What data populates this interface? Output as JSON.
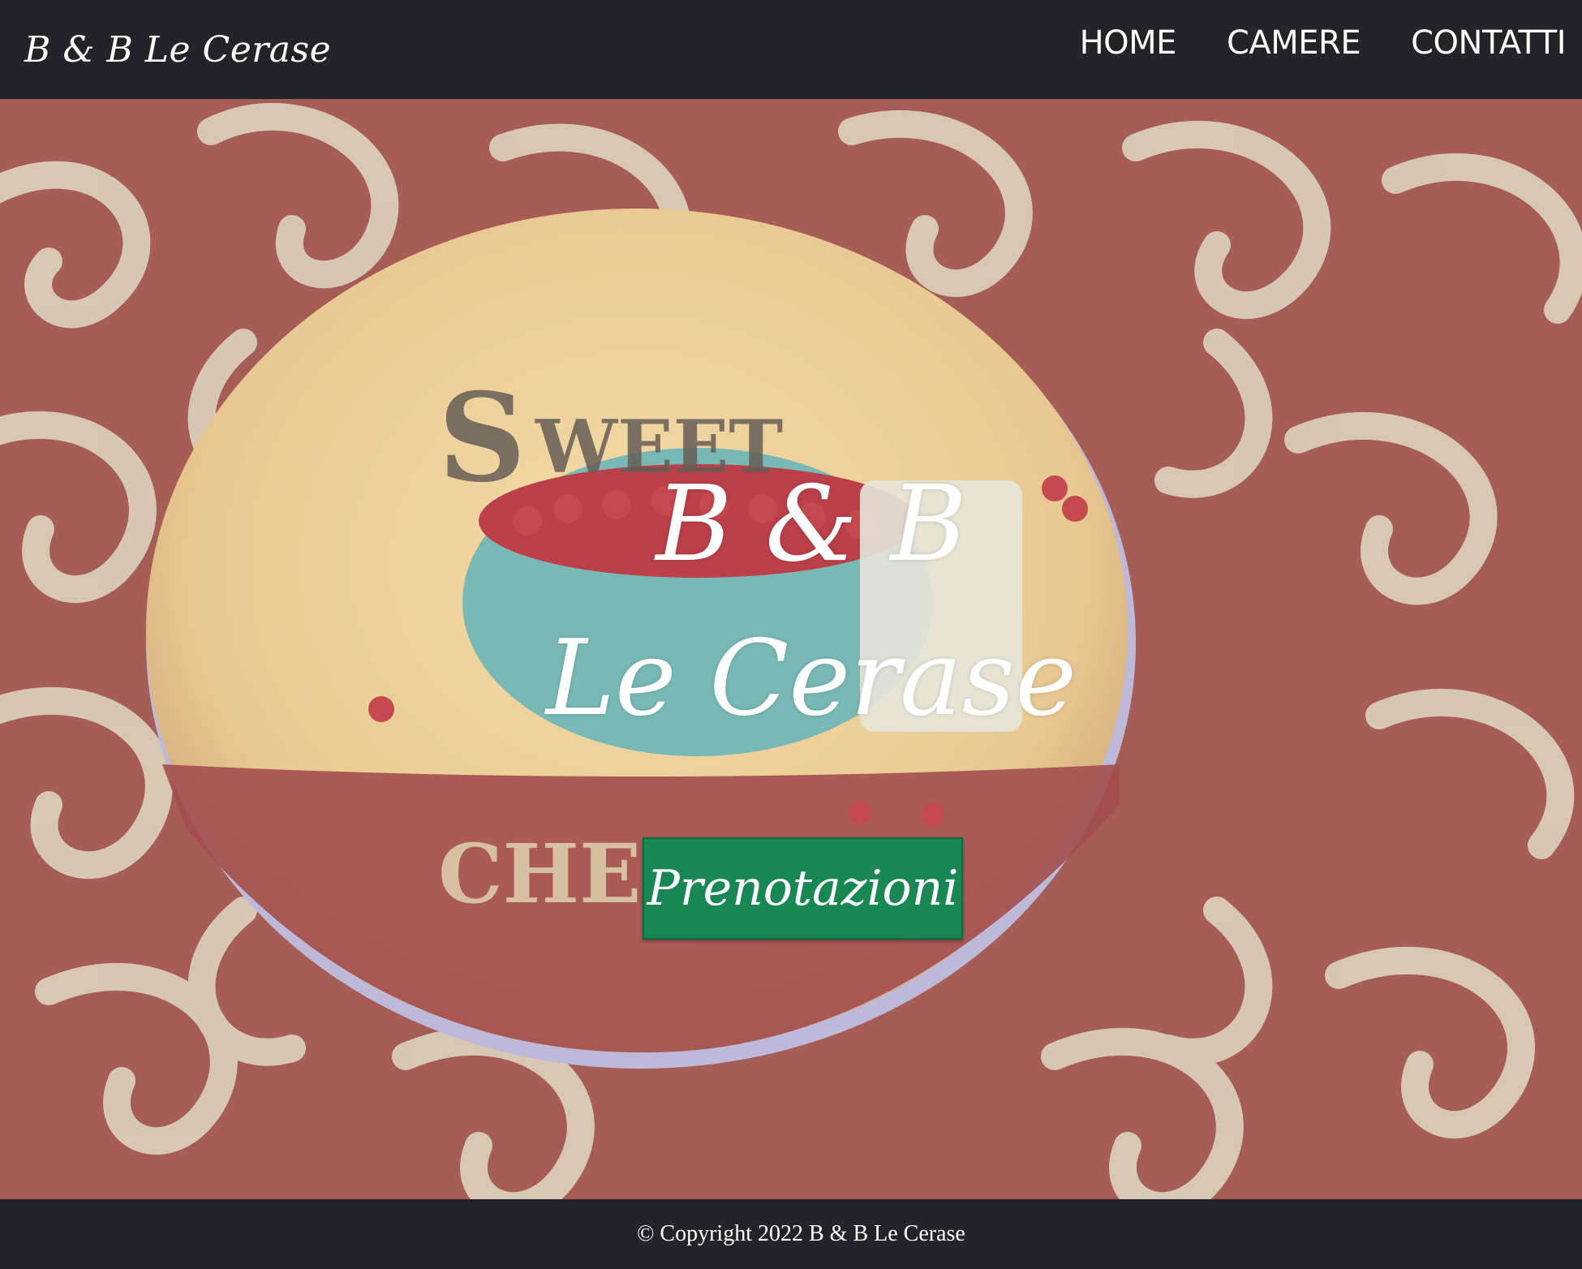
{
  "navbar": {
    "brand": "B & B Le Cerase",
    "links": [
      {
        "label": "HOME"
      },
      {
        "label": "CAMERE"
      },
      {
        "label": "CONTATTI"
      }
    ]
  },
  "hero": {
    "title_line1": "B & B",
    "title_line2": "Le Cerase",
    "button_label": "Prenotazioni"
  },
  "footer": {
    "copyright": "© Copyright 2022 B & B Le Cerase"
  },
  "colors": {
    "navbar_bg": "#212529",
    "button_bg": "#198754",
    "tablecloth": "#9c4d44"
  }
}
